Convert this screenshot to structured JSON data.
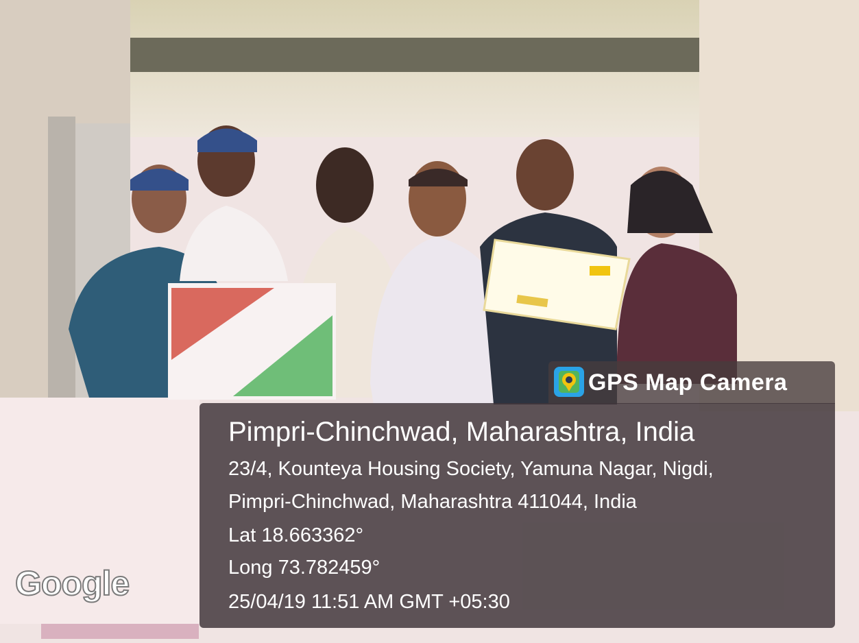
{
  "stamp": {
    "app_name": "GPS Map Camera",
    "app_icon": "map-camera-icon",
    "title": "Pimpri-Chinchwad, Maharashtra, India",
    "address_line1": "23/4, Kounteya Housing Society, Yamuna Nagar, Nigdi,",
    "address_line2": "Pimpri-Chinchwad, Maharashtra 411044, India",
    "latitude": "Lat 18.663362°",
    "longitude": "Long 73.782459°",
    "datetime": "25/04/19 11:51 AM GMT +05:30"
  },
  "map": {
    "logo": "Google"
  },
  "colors": {
    "panel": "#40363a",
    "icon": "#2aa3e6"
  }
}
